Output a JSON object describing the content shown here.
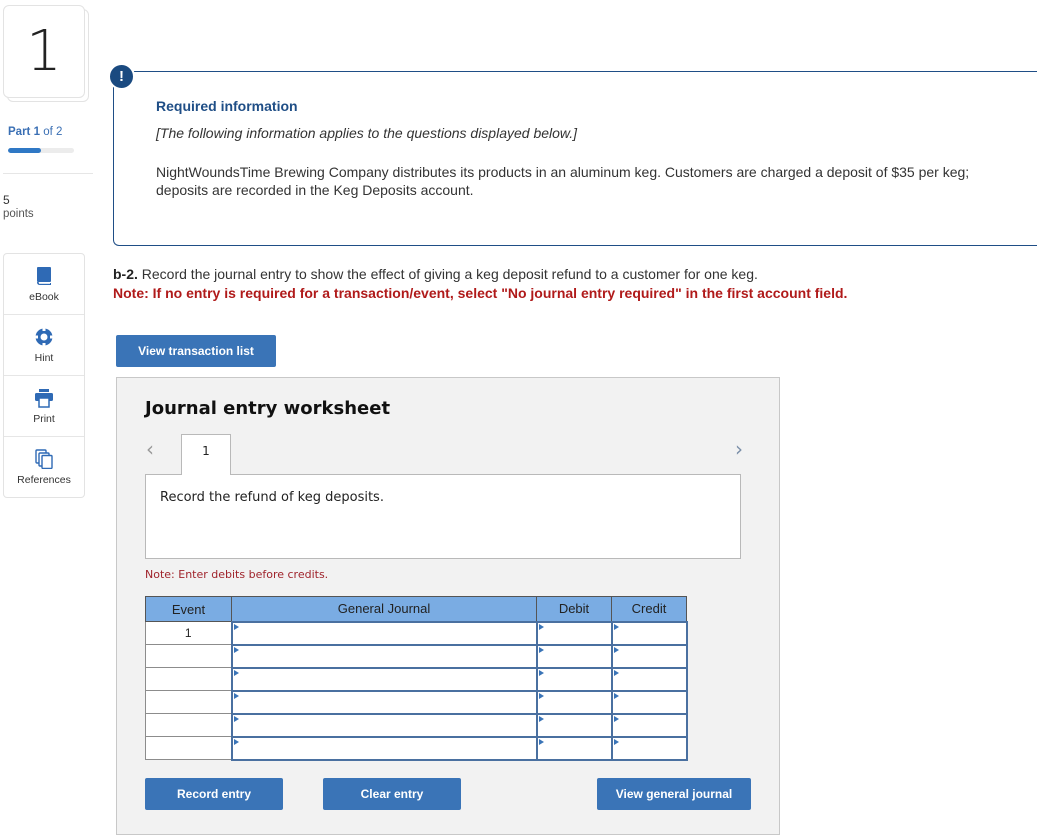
{
  "sidebar": {
    "question_number": "1",
    "part": {
      "prefix": "Part",
      "current": "1",
      "of_text": "of 2",
      "progress_fraction": 0.5
    },
    "points": {
      "value": "5",
      "label": "points"
    },
    "tools": [
      {
        "label": "eBook",
        "icon": "book-icon"
      },
      {
        "label": "Hint",
        "icon": "lifebuoy-icon"
      },
      {
        "label": "Print",
        "icon": "printer-icon"
      },
      {
        "label": "References",
        "icon": "copy-documents-icon"
      }
    ]
  },
  "info": {
    "badge": "!",
    "title": "Required information",
    "subtitle": "[The following information applies to the questions displayed below.]",
    "body": "NightWoundsTime Brewing Company distributes its products in an aluminum keg. Customers are charged a deposit of $35 per keg; deposits are recorded in the Keg Deposits account."
  },
  "question": {
    "label": "b-2.",
    "text": " Record the journal entry to show the effect of giving a keg deposit refund to a customer for one keg.",
    "note": "Note: If no entry is required for a transaction/event, select \"No journal entry required\" in the first account field.",
    "view_transaction_list": "View transaction list"
  },
  "worksheet": {
    "title": "Journal entry worksheet",
    "prev": "‹",
    "next": "›",
    "tabs": [
      {
        "label": "1"
      }
    ],
    "description": "Record the refund of keg deposits.",
    "note": "Note: Enter debits before credits.",
    "table": {
      "headers": {
        "event": "Event",
        "general_journal": "General Journal",
        "debit": "Debit",
        "credit": "Credit"
      },
      "rows": [
        {
          "event": "1",
          "account": "",
          "debit": "",
          "credit": ""
        },
        {
          "event": "",
          "account": "",
          "debit": "",
          "credit": ""
        },
        {
          "event": "",
          "account": "",
          "debit": "",
          "credit": ""
        },
        {
          "event": "",
          "account": "",
          "debit": "",
          "credit": ""
        },
        {
          "event": "",
          "account": "",
          "debit": "",
          "credit": ""
        },
        {
          "event": "",
          "account": "",
          "debit": "",
          "credit": ""
        }
      ]
    },
    "buttons": {
      "record": "Record entry",
      "clear": "Clear entry",
      "view_general_journal": "View general journal"
    }
  },
  "colors": {
    "accent_blue": "#3a74b7",
    "info_navy": "#1f4e86",
    "note_red": "#b01a1a",
    "table_header": "#7aace3"
  }
}
